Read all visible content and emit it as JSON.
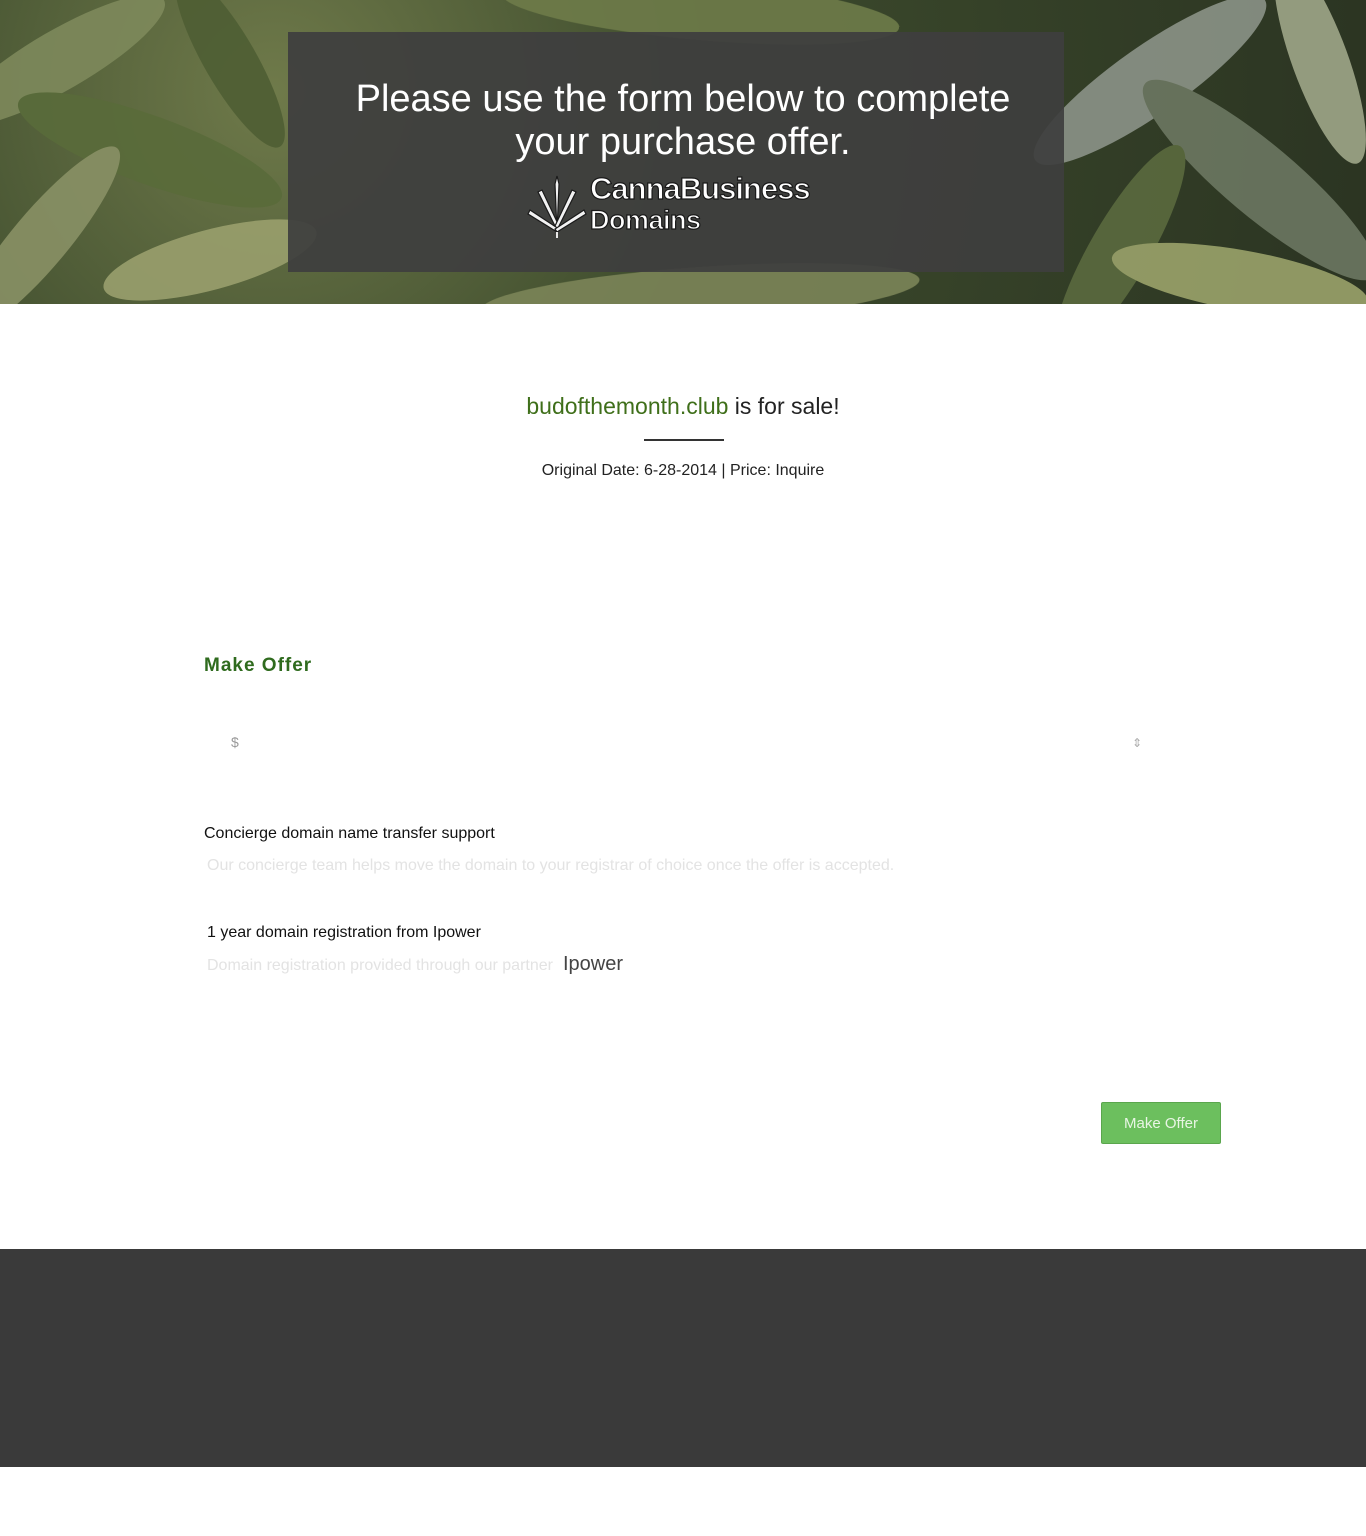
{
  "hero": {
    "title_line1": "Please use the form below to complete",
    "title_line2": "your purchase offer.",
    "logo_line1_a": "Canna",
    "logo_line1_b": "Business",
    "logo_line2": "Domains"
  },
  "listing": {
    "domain": "budofthemonth.club",
    "headline_suffix": " is for sale!",
    "meta": "Original Date: 6-28-2014 | Price: Inquire"
  },
  "offer": {
    "heading": "Make Offer",
    "currency_symbol": "$",
    "stepper_glyph": "⇕",
    "submit_label": "Make Offer"
  },
  "features": [
    {
      "title": "Concierge domain name transfer support",
      "description": "Our concierge team helps move the domain to your registrar of choice once the offer is accepted."
    },
    {
      "title": "1 year domain registration from Ipower",
      "description": "Domain registration provided through our partner",
      "brand": "Ipower"
    }
  ],
  "colors": {
    "accent_green": "#2f6b1e",
    "button_green": "#6cbf5e",
    "footer_bg": "#3a3a3a"
  }
}
